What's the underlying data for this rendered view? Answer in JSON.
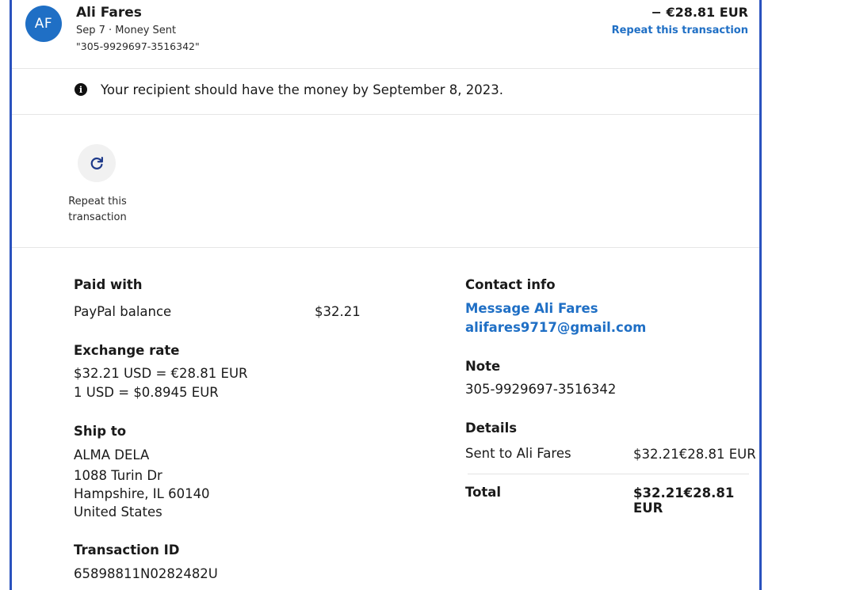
{
  "header": {
    "avatar_initials": "AF",
    "name": "Ali Fares",
    "subtitle": "Sep 7 · Money Sent",
    "reference": "\"305-9929697-3516342\"",
    "amount": "− €28.81 EUR",
    "repeat_link": "Repeat this transaction"
  },
  "notice": {
    "icon": "info-icon",
    "text": "Your recipient should have the money by September 8, 2023."
  },
  "actions": {
    "repeat_icon": "refresh-icon",
    "repeat_label": "Repeat this transaction"
  },
  "details": {
    "paid_with": {
      "heading": "Paid with",
      "method": "PayPal balance",
      "amount": "$32.21"
    },
    "exchange_rate": {
      "heading": "Exchange rate",
      "line1": "$32.21 USD = €28.81 EUR",
      "line2": "1 USD = $0.8945 EUR"
    },
    "ship_to": {
      "heading": "Ship to",
      "lines": [
        "ALMA DELA",
        "1088 Turin Dr",
        "Hampshire, IL 60140",
        "United States"
      ]
    },
    "transaction_id": {
      "heading": "Transaction ID",
      "value": "65898811N0282482U"
    },
    "contact_info": {
      "heading": "Contact info",
      "message_link": "Message Ali Fares",
      "email_link": "alifares9717@gmail.com"
    },
    "note": {
      "heading": "Note",
      "value": "305-9929697-3516342"
    },
    "details_section": {
      "heading": "Details",
      "sent_label": "Sent to Ali Fares",
      "sent_amount": "$32.21€28.81 EUR",
      "total_label": "Total",
      "total_amount": "$32.21€28.81 EUR"
    }
  },
  "colors": {
    "accent": "#1f6fc5",
    "frame_border": "#2a52be"
  }
}
